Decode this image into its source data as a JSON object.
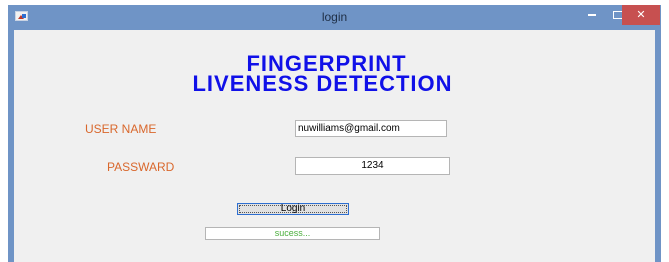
{
  "window": {
    "title": "login",
    "icon": "app-figure-icon",
    "controls": {
      "minimize_icon": "minimize-icon",
      "maximize_icon": "maximize-icon",
      "close_label": "✕"
    }
  },
  "heading": {
    "line1": "FINGERPRINT",
    "line2": "LIVENESS DETECTION"
  },
  "form": {
    "username_label": "USER NAME",
    "username_value": "nuwilliams@gmail.com",
    "password_label": "PASSWARD",
    "password_value": "1234",
    "login_label": "Login",
    "status_value": "sucess..."
  },
  "colors": {
    "titlebar": "#6f94c6",
    "heading": "#1010e8",
    "label": "#d9672c",
    "status_text": "#4caf3e",
    "close_button": "#c75050"
  }
}
